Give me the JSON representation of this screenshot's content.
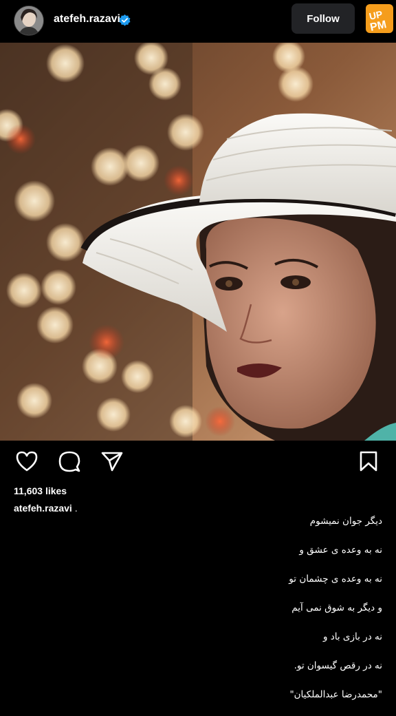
{
  "header": {
    "username": "atefeh.razavi",
    "follow_label": "Follow",
    "verified_icon": "verified-badge-icon",
    "verified_color": "#1d9bf0",
    "watermark_text": "PM"
  },
  "post": {
    "image_description_icon": "portrait-photo",
    "actions": {
      "like_icon": "heart-icon",
      "comment_icon": "comment-icon",
      "share_icon": "send-icon",
      "save_icon": "bookmark-icon"
    },
    "likes_text": "11,603 likes",
    "caption_username": "atefeh.razavi",
    "caption_suffix": ".",
    "caption_lines": [
      "دیگر جوان نمیشوم",
      "نه به وعده ی عشق و",
      "نه به وعده ی چشمان تو",
      "و دیگر به شوق نمی آیم",
      "نه در بازی باد و",
      "نه در رقص گیسوان تو.",
      "\"محمدرضا عبدالملکیان\""
    ]
  },
  "colors": {
    "background": "#000000",
    "follow_button_bg": "#222326",
    "watermark_orange": "#f59d1c"
  }
}
